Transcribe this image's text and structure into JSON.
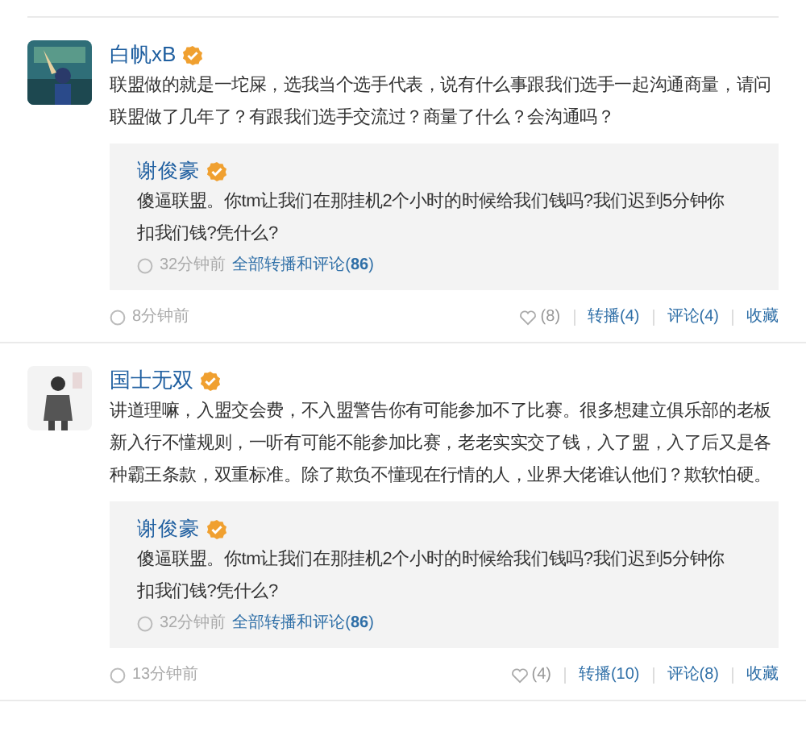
{
  "posts": [
    {
      "author": "白帆xB",
      "verified": true,
      "text": "联盟做的就是一坨屎，选我当个选手代表，说有什么事跟我们选手一起沟通商量，请问联盟做了几年了？有跟我们选手交流过？商量了什么？会沟通吗？",
      "quote": {
        "author": "谢俊豪",
        "verified": true,
        "text": "傻逼联盟。你tm让我们在那挂机2个小时的时候给我们钱吗?我们迟到5分钟你扣我们钱?凭什么?",
        "time": "32分钟前",
        "link": "全部转播和评论(**86**)"
      },
      "time": "8分钟前",
      "likes": "(8)",
      "actions": [
        "转播(4)",
        "评论(4)",
        "收藏"
      ]
    },
    {
      "author": "国士无双",
      "verified": true,
      "text": "讲道理嘛，入盟交会费，不入盟警告你有可能参加不了比赛。很多想建立俱乐部的老板新入行不懂规则，一听有可能不能参加比赛，老老实实交了钱，入了盟，入了后又是各种霸王条款，双重标准。除了欺负不懂现在行情的人，业界大佬谁认他们？欺软怕硬。",
      "quote": {
        "author": "谢俊豪",
        "verified": true,
        "text": "傻逼联盟。你tm让我们在那挂机2个小时的时候给我们钱吗?我们迟到5分钟你扣我们钱?凭什么?",
        "time": "32分钟前",
        "link": "全部转播和评论(**86**)"
      },
      "time": "13分钟前",
      "likes": "(4)",
      "actions": [
        "转播(10)",
        "评论(8)",
        "收藏"
      ]
    }
  ]
}
